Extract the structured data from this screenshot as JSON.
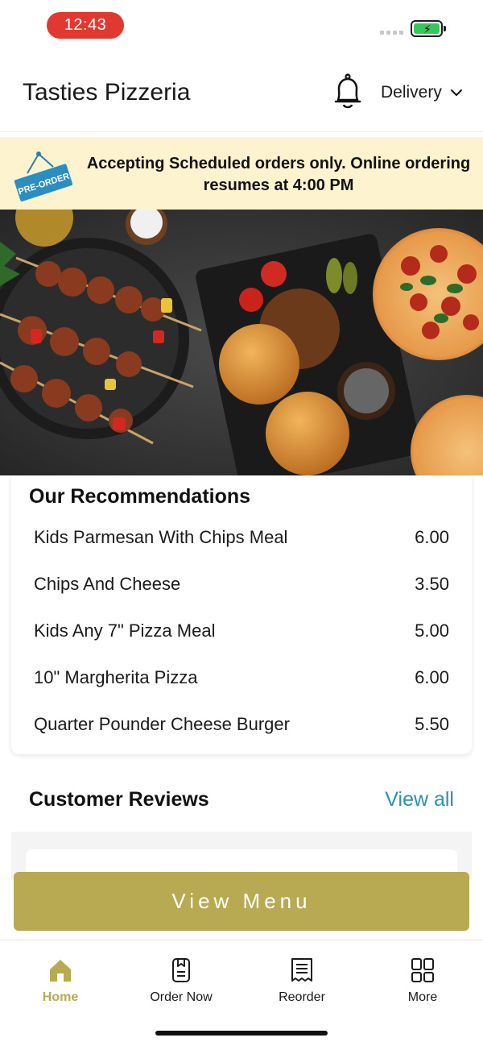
{
  "status": {
    "time": "12:43"
  },
  "header": {
    "title": "Tasties Pizzeria",
    "delivery_label": "Delivery"
  },
  "banner": {
    "badge": "PRE-ORDER",
    "message": "Accepting Scheduled orders only. Online ordering resumes at 4:00 PM"
  },
  "recommendations": {
    "title": "Our Recommendations",
    "items": [
      {
        "name": "Kids Parmesan With Chips Meal",
        "price": "6.00"
      },
      {
        "name": "Chips And Cheese",
        "price": "3.50"
      },
      {
        "name": "Kids Any 7\" Pizza Meal",
        "price": "5.00"
      },
      {
        "name": "10\" Margherita Pizza",
        "price": "6.00"
      },
      {
        "name": "Quarter Pounder Cheese Burger",
        "price": "5.50"
      }
    ]
  },
  "reviews": {
    "title": "Customer Reviews",
    "view_all": "View all"
  },
  "cta": {
    "view_menu": "View Menu"
  },
  "tabs": [
    {
      "label": "Home",
      "icon": "home-icon",
      "active": true
    },
    {
      "label": "Order Now",
      "icon": "order-icon",
      "active": false
    },
    {
      "label": "Reorder",
      "icon": "receipt-icon",
      "active": false
    },
    {
      "label": "More",
      "icon": "grid-icon",
      "active": false
    }
  ],
  "colors": {
    "accent": "#b7aa53",
    "link": "#2a8fb3",
    "banner_bg": "#fdf3cf",
    "time_pill": "#e0392f"
  }
}
